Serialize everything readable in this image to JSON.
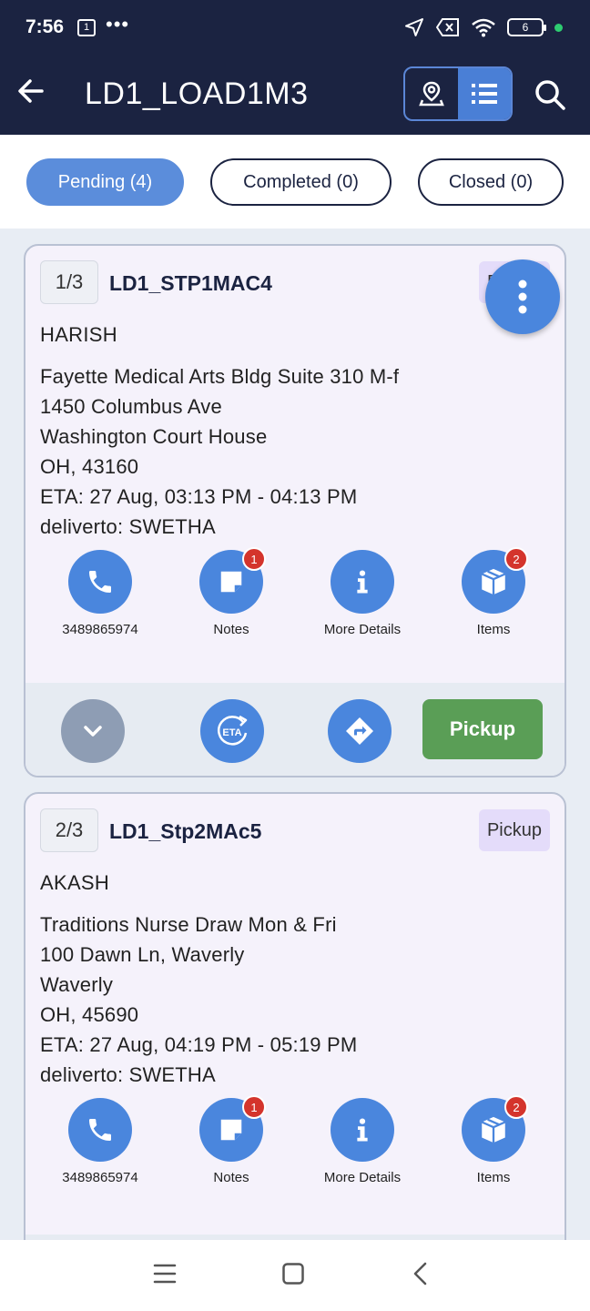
{
  "status_bar": {
    "time": "7:56",
    "calendar": "1",
    "more": "•••",
    "battery": "6"
  },
  "header": {
    "title": "LD1_LOAD1M3"
  },
  "tabs": [
    {
      "label": "Pending (4)",
      "active": true
    },
    {
      "label": "Completed (0)",
      "active": false
    },
    {
      "label": "Closed (0)",
      "active": false
    }
  ],
  "stops": [
    {
      "seq": "1/3",
      "id": "LD1_STP1MAC4",
      "type": "Pickup",
      "contact": "HARISH",
      "address_lines": [
        "Fayette Medical Arts Bldg Suite 310 M-f",
        "1450 Columbus Ave",
        "Washington Court House",
        "OH, 43160",
        "ETA: 27 Aug, 03:13 PM - 04:13 PM",
        "deliverto: SWETHA"
      ],
      "actions": {
        "phone": "3489865974",
        "notes": "Notes",
        "notes_badge": "1",
        "details": "More Details",
        "items": "Items",
        "items_badge": "2"
      },
      "primary_action": "Pickup"
    },
    {
      "seq": "2/3",
      "id": "LD1_Stp2MAc5",
      "type": "Pickup",
      "contact": "AKASH",
      "address_lines": [
        "Traditions Nurse Draw Mon & Fri",
        "100 Dawn Ln, Waverly",
        "Waverly",
        "OH, 45690",
        "ETA: 27 Aug, 04:19 PM - 05:19 PM",
        "deliverto: SWETHA"
      ],
      "actions": {
        "phone": "3489865974",
        "notes": "Notes",
        "notes_badge": "1",
        "details": "More Details",
        "items": "Items",
        "items_badge": "2"
      }
    }
  ],
  "colors": {
    "header_bg": "#1b2341",
    "accent": "#4a86dd",
    "pickup_green": "#5a9e56",
    "badge_red": "#d4342c"
  },
  "icons": [
    "back-arrow-icon",
    "map-pin-icon",
    "list-icon",
    "search-icon",
    "phone-icon",
    "notes-icon",
    "info-icon",
    "box-icon",
    "chevron-down-icon",
    "eta-icon",
    "directions-icon",
    "more-vertical-icon"
  ]
}
